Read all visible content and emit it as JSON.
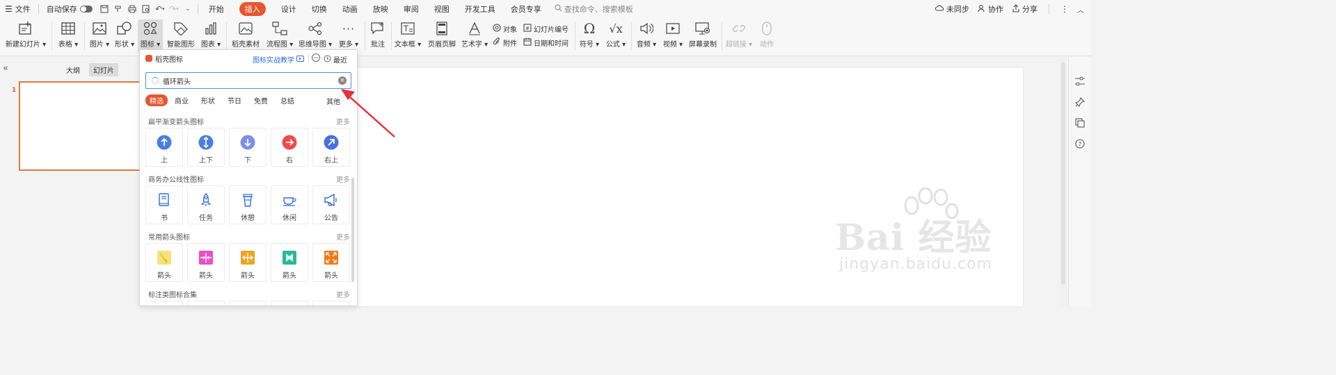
{
  "menubar": {
    "file": "文件",
    "autosave": "自动保存",
    "tabs": [
      "开始",
      "插入",
      "设计",
      "切换",
      "动画",
      "放映",
      "审阅",
      "视图",
      "开发工具",
      "会员专享"
    ],
    "active_tab": "插入",
    "search_placeholder": "查找命令、搜索模板",
    "unsynced": "未同步",
    "collab": "协作",
    "share": "分享"
  },
  "ribbon": {
    "new_slide": "新建幻灯片",
    "table": "表格",
    "picture": "图片",
    "shape": "形状",
    "icon": "图标",
    "smart_graphic": "智能图形",
    "chart": "图表",
    "daoke_material": "稻壳素材",
    "flowchart": "流程图",
    "mindmap": "思维导图",
    "more": "更多",
    "comment": "批注",
    "textbox": "文本框",
    "header_footer": "页眉页脚",
    "wordart": "艺术字",
    "object": "对象",
    "attachment": "附件",
    "slide_number": "幻灯片编号",
    "date_time": "日期和时间",
    "symbol": "符号",
    "formula": "公式",
    "audio": "音频",
    "video": "视频",
    "screen_record": "屏幕录制",
    "hyperlink": "超链接",
    "action": "动作"
  },
  "leftpanel": {
    "outline_tab": "大纲",
    "slides_tab": "幻灯片",
    "slide_number": "1"
  },
  "popup": {
    "title": "稻壳图标",
    "tutorial": "图标实战教学",
    "recent": "最近",
    "search_value": "循环箭头",
    "categories": [
      "精选",
      "商业",
      "形状",
      "节日",
      "免费",
      "总结"
    ],
    "category_other": "其他",
    "more_label": "更多",
    "sections": [
      {
        "title": "扁平渐变箭头图标",
        "items": [
          "上",
          "上下",
          "下",
          "右",
          "右上"
        ]
      },
      {
        "title": "商务办公线性图标",
        "items": [
          "书",
          "任务",
          "休憩",
          "休闲",
          "公告"
        ]
      },
      {
        "title": "常用箭头图标",
        "items": [
          "箭头",
          "箭头",
          "箭头",
          "箭头",
          "箭头"
        ]
      },
      {
        "title": "标注类图标合集",
        "items": []
      }
    ]
  },
  "watermark": {
    "brand_text": "Bai 经验",
    "url": "jingyan.baidu.com"
  },
  "colors": {
    "accent": "#e8552f",
    "link": "#2f6fd6",
    "icon_blue": "#4a7fe0",
    "icon_red": "#ef4b4b"
  }
}
